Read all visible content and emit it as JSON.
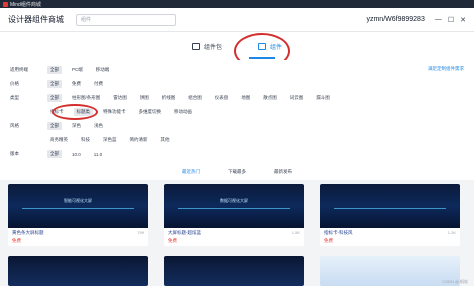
{
  "titlebar": {
    "title": "Mind组件商城"
  },
  "header": {
    "app_title": "设计器组件商城",
    "search_placeholder": "组件",
    "user": "yzmn/W6f9899283",
    "min": "—",
    "max": "☐",
    "close": "✕"
  },
  "tabs": [
    {
      "label": "组件包",
      "icon": "folder-icon"
    },
    {
      "label": "组件",
      "icon": "component-icon"
    }
  ],
  "filters": {
    "custom_link": "满足定制组件需求",
    "rows": [
      {
        "label": "适用终端",
        "chips": [
          "全部",
          "PC端",
          "移动端"
        ],
        "active": 0
      },
      {
        "label": "价格",
        "chips": [
          "全部",
          "免费",
          "付费"
        ],
        "active": 0
      },
      {
        "label": "类型",
        "chips": [
          "全部",
          "柱形图/条形图",
          "雷达图",
          "饼图",
          "折线图",
          "组合图",
          "仪表盘",
          "地图",
          "散点图",
          "词云图",
          "漏斗图"
        ],
        "active": 0
      },
      {
        "label": "",
        "chips": [
          "指标卡",
          "标题类",
          "特殊功能卡",
          "多维度切换",
          "移动动画"
        ],
        "active": 1
      },
      {
        "label": "风格",
        "chips": [
          "全部",
          "深色",
          "浅色"
        ],
        "active": 0
      },
      {
        "label": "",
        "chips": [
          "商务精英",
          "科技",
          "深色蓝",
          "简约清新",
          "其他"
        ],
        "active": -1
      },
      {
        "label": "版本",
        "chips": [
          "全部",
          "10.0",
          "11.0"
        ],
        "active": 0
      }
    ]
  },
  "sort": {
    "items": [
      "最近热门",
      "下载最多",
      "最新发布"
    ],
    "active": 0
  },
  "cards": [
    {
      "name": "黄色条大屏标题",
      "price": "免费",
      "views": "799",
      "thumb_title": "智能可视化大屏"
    },
    {
      "name": "大屏标题-超炫蓝",
      "price": "免费",
      "views": "1.5K",
      "thumb_title": "数据可视化大屏"
    },
    {
      "name": "指标卡-科技风",
      "price": "免费",
      "views": "1.2K",
      "thumb_title": ""
    }
  ],
  "watermark": "CSDN @ 帆软"
}
